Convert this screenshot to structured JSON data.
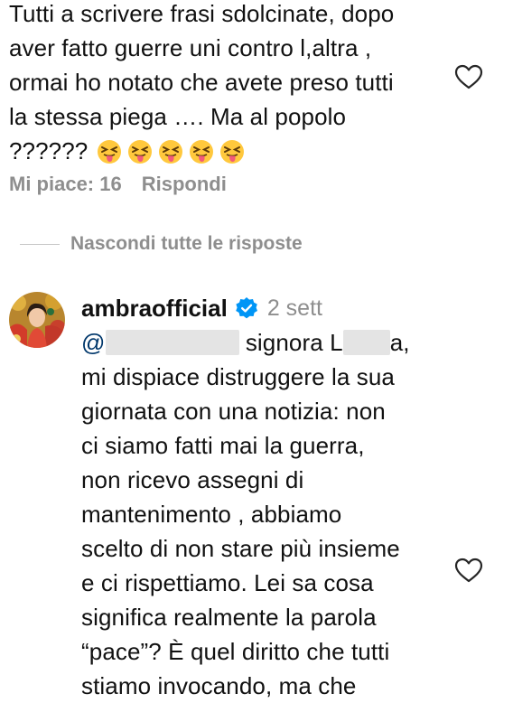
{
  "comment1": {
    "lines": [
      "Tutti a scrivere frasi sdolcinate, dopo",
      "aver fatto guerre uni contro l,altra ,",
      "ormai ho notato che avete preso tutti",
      "la stessa piega …. Ma al popolo",
      "??????"
    ],
    "emojis": [
      "squinting-face-with-tongue",
      "squinting-face-with-tongue",
      "squinting-face-with-tongue",
      "squinting-face-with-tongue",
      "squinting-face-with-tongue"
    ],
    "likes_label": "Mi piace: 16",
    "reply_label": "Rispondi"
  },
  "replies_toggle": "Nascondi tutte le risposte",
  "comment2": {
    "username": "ambraofficial",
    "verified": true,
    "time": "2 sett",
    "mention_prefix": "@",
    "line1_after_mention": "signora L",
    "line1_end": "a,",
    "lines": [
      "mi dispiace distruggere la sua",
      "giornata con una notizia: non",
      "ci siamo fatti mai la guerra,",
      "non ricevo assegni di",
      "mantenimento , abbiamo",
      "scelto di non stare più insieme",
      "e ci rispettiamo. Lei sa cosa",
      "significa realmente la parola",
      "“pace”? È quel diritto che tutti",
      "stiamo invocando, ma che"
    ]
  },
  "colors": {
    "text": "#111111",
    "secondary": "#8e8e8e",
    "verified_blue": "#0095f6",
    "mention": "#00376b"
  },
  "icons": {
    "like": "heart-outline-icon",
    "verified": "verified-badge-icon"
  }
}
